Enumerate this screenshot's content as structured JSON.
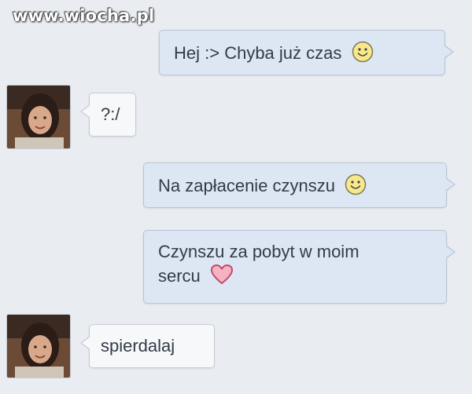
{
  "watermark": "www.wiocha.pl",
  "messages": [
    {
      "direction": "outgoing",
      "text": "Hej :> Chyba już czas",
      "emoji": "smiley"
    },
    {
      "direction": "incoming",
      "text": "?:/"
    },
    {
      "direction": "outgoing",
      "text": "Na zapłacenie czynszu",
      "emoji": "smiley"
    },
    {
      "direction": "outgoing",
      "lines": [
        "Czynszu za pobyt w moim",
        "sercu"
      ],
      "emoji": "heart"
    },
    {
      "direction": "incoming",
      "text": "spierdalaj"
    }
  ],
  "colors": {
    "background": "#e9ecf1",
    "outgoing_bubble": "#dde7f4",
    "incoming_bubble": "#f7f8fa",
    "text": "#333b48"
  }
}
